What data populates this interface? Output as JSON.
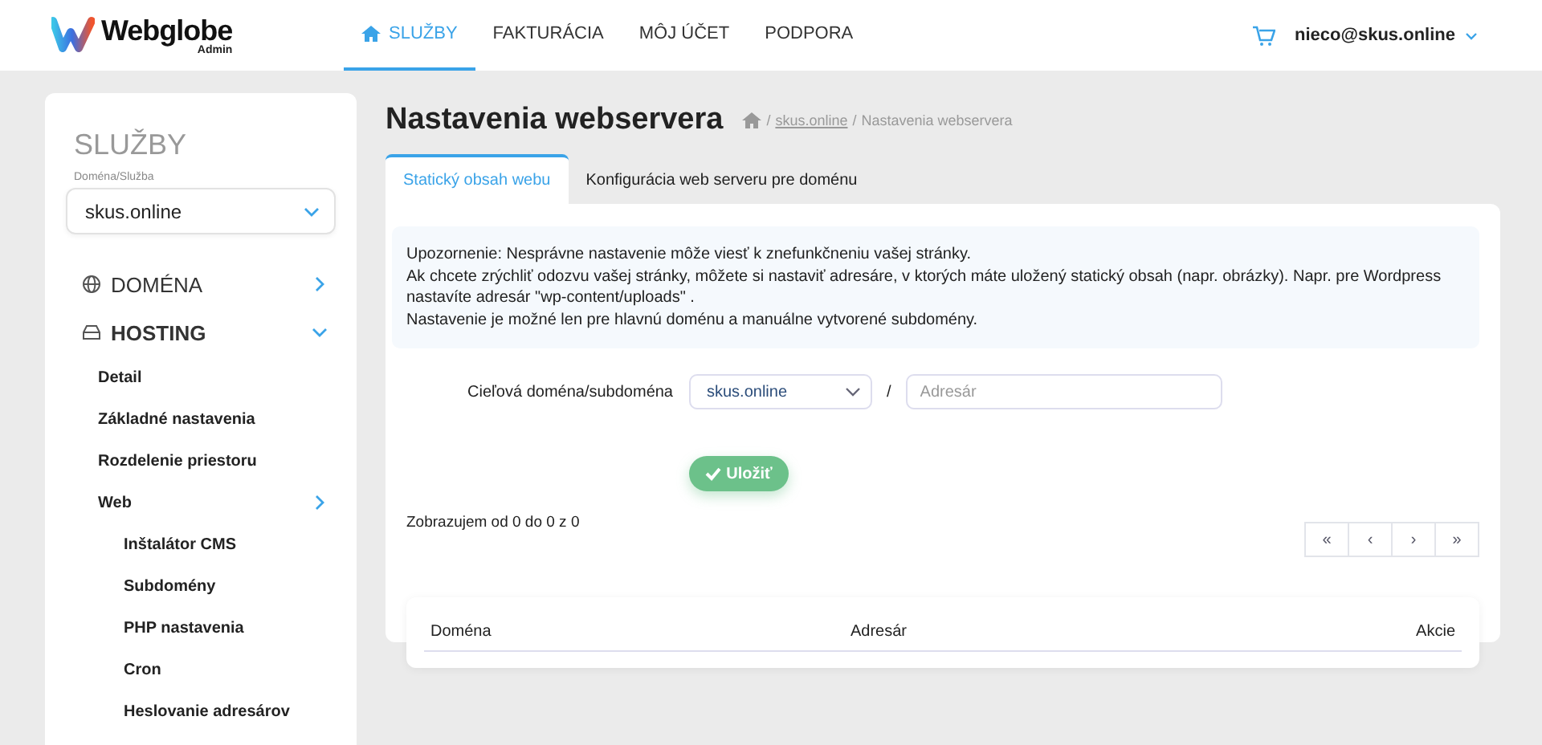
{
  "header": {
    "logo": "Webglobe",
    "logo_sub": "Admin",
    "nav": [
      {
        "label": "SLUŽBY",
        "selected": true
      },
      {
        "label": "FAKTURÁCIA",
        "selected": false
      },
      {
        "label": "MÔJ ÚČET",
        "selected": false
      },
      {
        "label": "PODPORA",
        "selected": false
      }
    ],
    "user": "nieco@skus.online"
  },
  "sidebar": {
    "title": "SLUŽBY",
    "select_label": "Doména/Služba",
    "select_value": "skus.online",
    "items": [
      {
        "label": "DOMÉNA",
        "kind": "domain",
        "expanded": false
      },
      {
        "label": "HOSTING",
        "kind": "hosting",
        "expanded": true,
        "children": [
          {
            "label": "Detail"
          },
          {
            "label": "Základné nastavenia"
          },
          {
            "label": "Rozdelenie priestoru"
          },
          {
            "label": "Web",
            "expanded": false,
            "children": [
              {
                "label": "Inštalátor CMS"
              },
              {
                "label": "Subdomény"
              },
              {
                "label": "PHP nastavenia"
              },
              {
                "label": "Cron"
              },
              {
                "label": "Heslovanie adresárov"
              }
            ]
          }
        ]
      }
    ]
  },
  "page": {
    "title": "Nastavenia webservera",
    "breadcrumb": [
      {
        "separator": "/",
        "label": "skus.online",
        "kind": "link"
      },
      {
        "separator": "/",
        "label": "Nastavenia webservera",
        "kind": "current"
      }
    ],
    "tabs": [
      {
        "label": "Statický obsah webu",
        "selected": true
      },
      {
        "label": "Konfigurácia web serveru pre doménu",
        "selected": false
      }
    ],
    "notice": [
      "Upozornenie: Nesprávne nastavenie môže viesť k znefunkčneniu vašej stránky.",
      "Ak chcete zrýchliť odozvu vašej stránky, môžete si nastaviť adresáre, v ktorých máte uložený statický obsah (napr. obrázky). Napr. pre Wordpress nastavíte adresár \"wp-content/uploads\" .",
      "Nastavenie je možné len pre hlavnú doménu a manuálne vytvorené subdomény."
    ],
    "form": {
      "label": "Cieľová doména/subdoména",
      "domain": "skus.online",
      "separator": "/",
      "path_placeholder": "Adresár",
      "save": "Uložiť"
    },
    "summary": "Zobrazujem od 0 do 0 z 0",
    "pagination": [
      "«",
      "‹",
      "›",
      "»"
    ],
    "table": {
      "columns": [
        "Doména",
        "Adresár",
        "Akcie"
      ]
    }
  }
}
